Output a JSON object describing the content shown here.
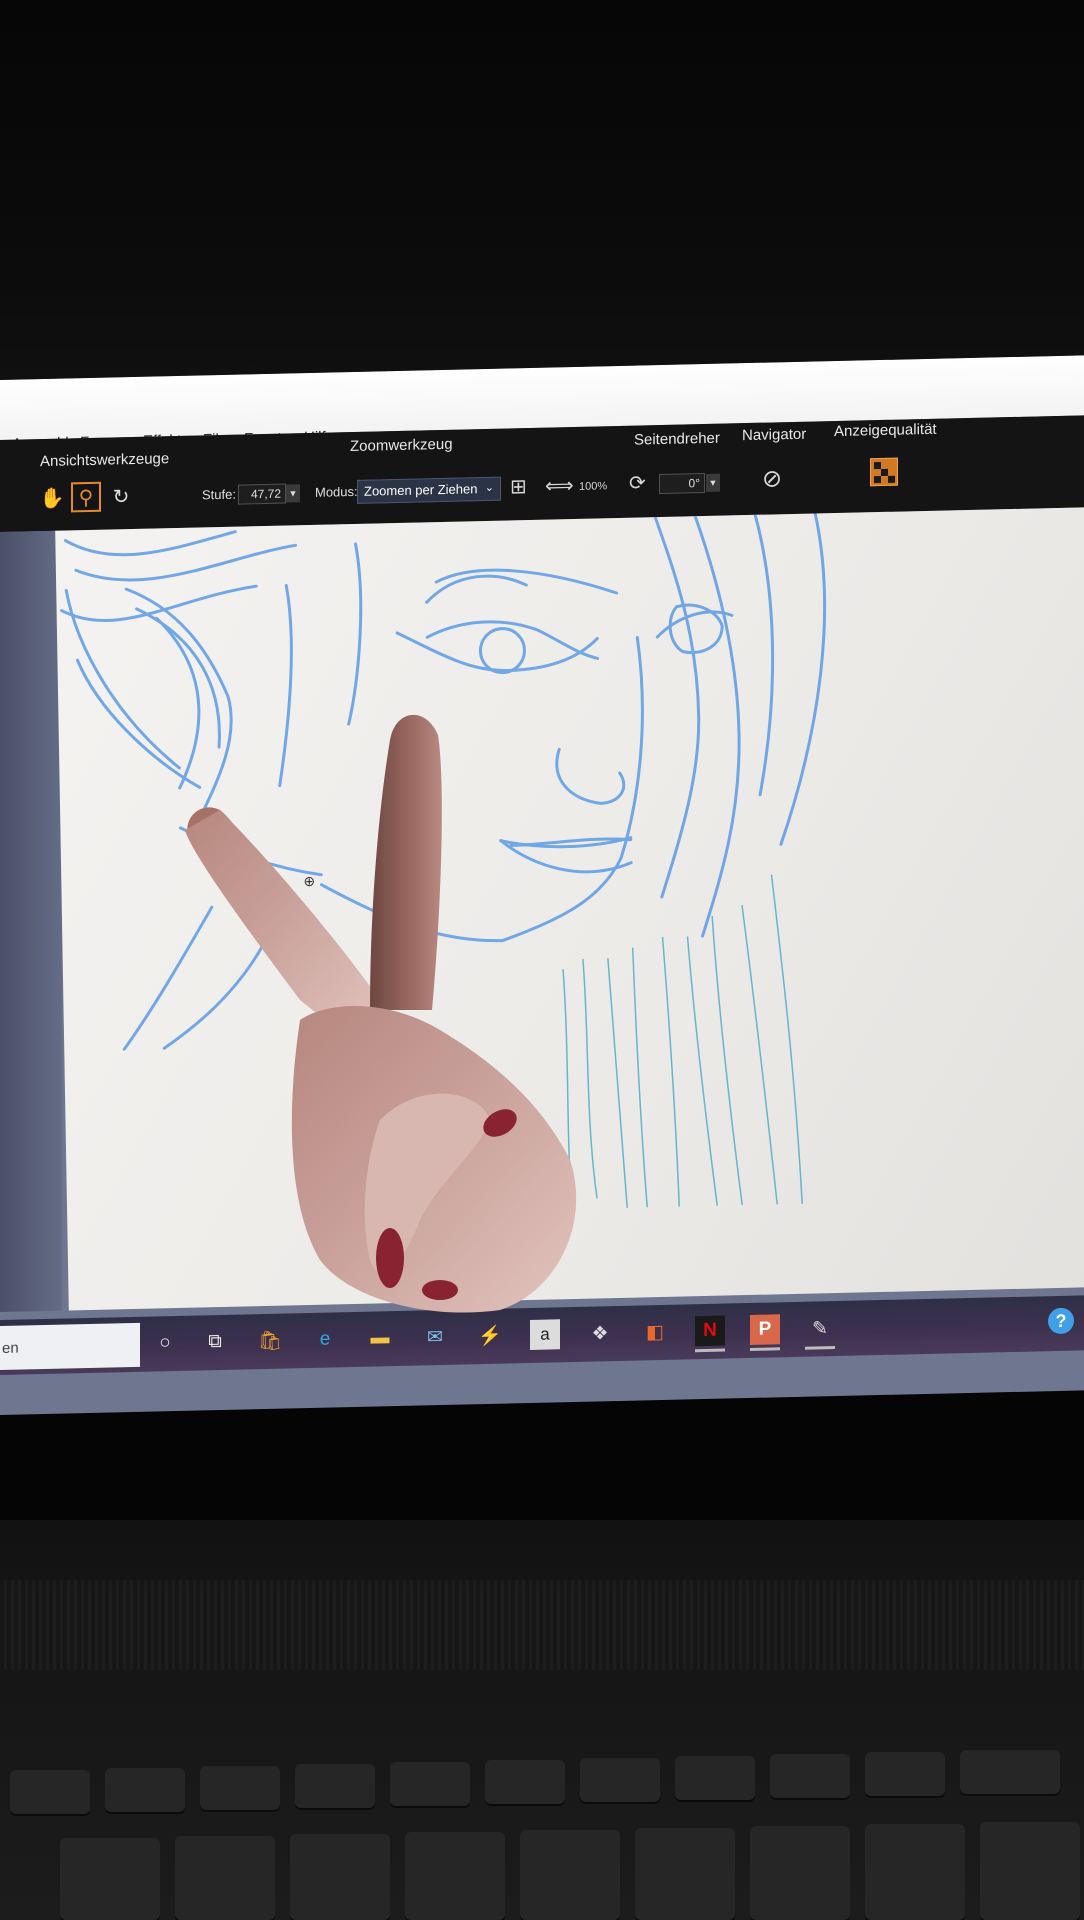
{
  "menu": [
    "Auswahl",
    "Formen",
    "Effekte",
    "Film",
    "Fenster",
    "Hilfe"
  ],
  "ribbon": {
    "view_tools": {
      "title": "Ansichtswerkzeuge",
      "active_tool": "zoom"
    },
    "zoom": {
      "title": "Zoomwerkzeug",
      "level_label": "Stufe:",
      "level_value": "47,72",
      "mode_label": "Modus:",
      "mode_value": "Zoomen per Ziehen",
      "percent_button": "100%"
    },
    "rotate": {
      "title": "Seitendreher",
      "angle_value": "0°"
    },
    "navigator": {
      "title": "Navigator"
    },
    "display_quality": {
      "title": "Anzeigequalität"
    }
  },
  "taskbar": {
    "search_text": "en",
    "icons": [
      "cortana-icon",
      "task-view-icon",
      "store-icon",
      "edge-icon",
      "file-explorer-icon",
      "mail-icon",
      "lightning-app-icon",
      "amazon-icon",
      "dropbox-icon",
      "office-icon",
      "netflix-icon",
      "presentation-icon",
      "drawing-app-icon"
    ]
  },
  "colors": {
    "ribbon_bg": "#141414",
    "accent": "#e68a2a",
    "sketch_line": "#5b9be6",
    "taskbar_bg": "#3e3150"
  }
}
